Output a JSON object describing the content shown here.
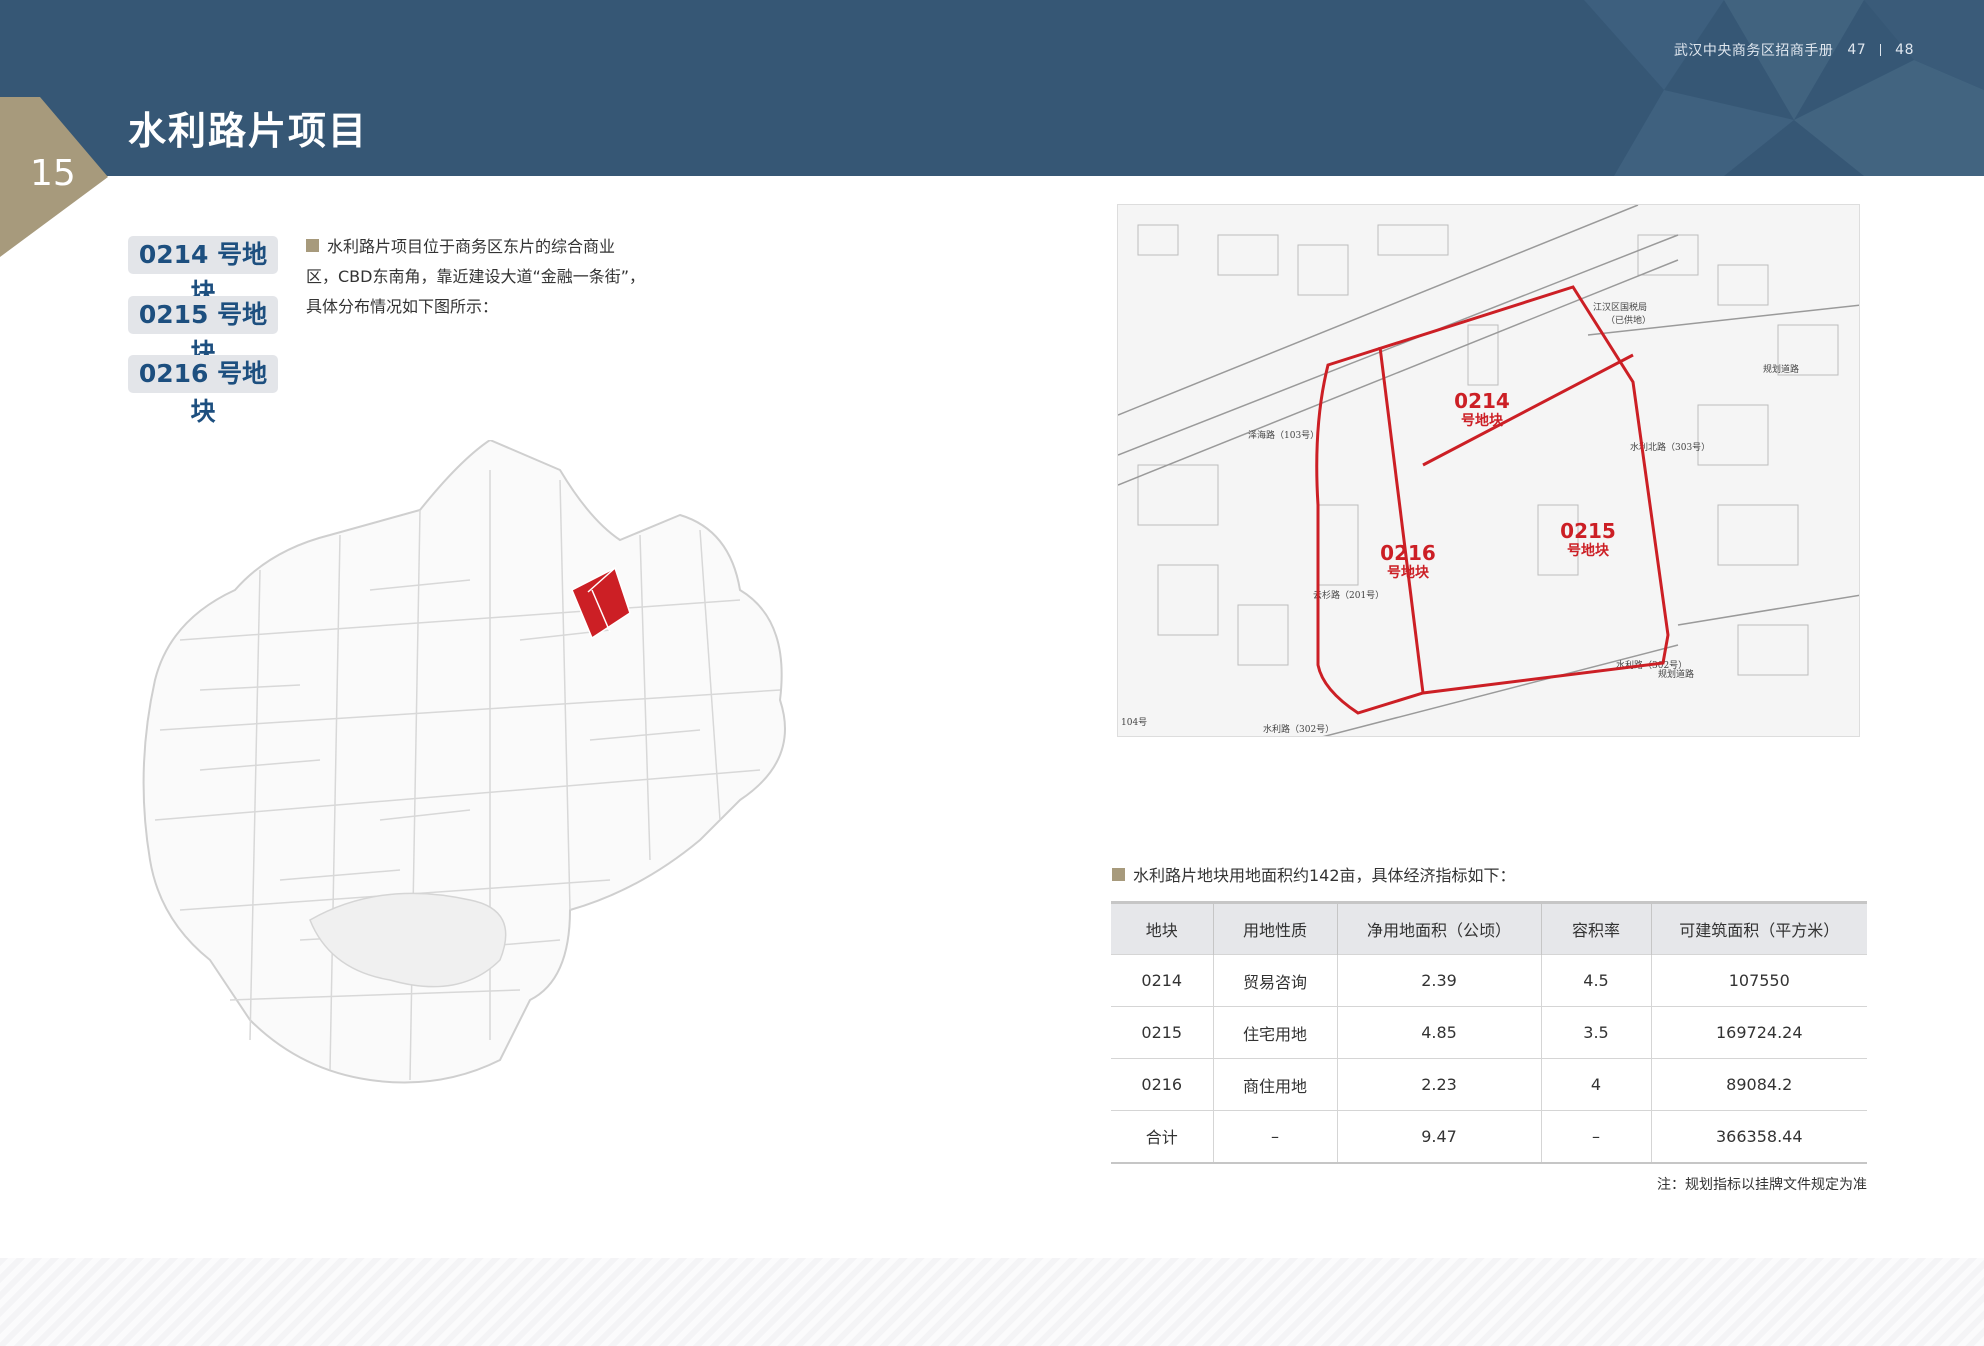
{
  "header": {
    "book_title": "武汉中央商务区招商手册",
    "page_left": "47",
    "page_right": "48",
    "chapter_number": "15",
    "page_title": "水利路片项目",
    "colors": {
      "header_bg": "#365775",
      "gold": "#a79a7c",
      "highlight_red": "#cc1f25"
    }
  },
  "plot_tags": [
    "0214 号地块",
    "0215 号地块",
    "0216 号地块"
  ],
  "intro_text": "水利路片项目位于商务区东片的综合商业区，CBD东南角，靠近建设大道“金融一条街”，具体分布情况如下图所示：",
  "site_map": {
    "plots": [
      {
        "code": "0214",
        "label": "号地块"
      },
      {
        "code": "0215",
        "label": "号地块"
      },
      {
        "code": "0216",
        "label": "号地块"
      }
    ],
    "road_labels": [
      "江汉区国税局",
      "（已供地）",
      "规划道路",
      "泽海路（103号）",
      "水利北路（303号）",
      "云杉路（201号）",
      "水利路（302号）",
      "水利路（302号）",
      "规划道路",
      "104号"
    ]
  },
  "table_intro": "水利路片地块用地面积约142亩，具体经济指标如下：",
  "table": {
    "headers": [
      "地块",
      "用地性质",
      "净用地面积（公顷）",
      "容积率",
      "可建筑面积（平方米）"
    ],
    "rows": [
      [
        "0214",
        "贸易咨询",
        "2.39",
        "4.5",
        "107550"
      ],
      [
        "0215",
        "住宅用地",
        "4.85",
        "3.5",
        "169724.24"
      ],
      [
        "0216",
        "商住用地",
        "2.23",
        "4",
        "89084.2"
      ],
      [
        "合计",
        "–",
        "9.47",
        "–",
        "366358.44"
      ]
    ]
  },
  "note": "注：规划指标以挂牌文件规定为准"
}
